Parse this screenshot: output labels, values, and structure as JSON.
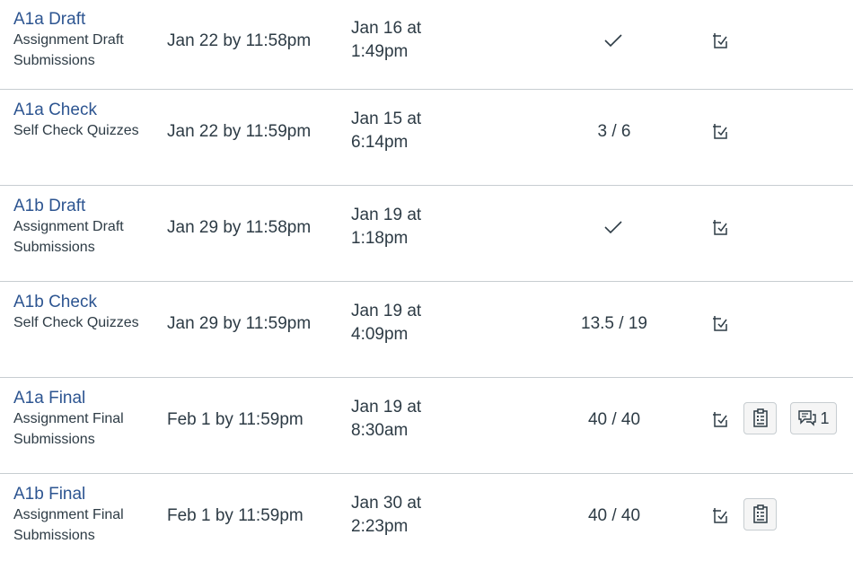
{
  "rows": [
    {
      "name": "A1a Draft",
      "group": "Assignment Draft Submissions",
      "due": "Jan 22 by 11:58pm",
      "submitted_line1": "Jan 16 at",
      "submitted_line2": "1:49pm",
      "score": "",
      "score_icon": "checkmark-icon"
    },
    {
      "name": "A1a Check",
      "group": "Self Check Quizzes",
      "due": "Jan 22 by 11:59pm",
      "submitted_line1": "Jan 15 at",
      "submitted_line2": "6:14pm",
      "score": "3 / 6"
    },
    {
      "name": "A1b Draft",
      "group": "Assignment Draft Submissions",
      "due": "Jan 29 by 11:58pm",
      "submitted_line1": "Jan 19 at",
      "submitted_line2": "1:18pm",
      "score": "",
      "score_icon": "checkmark-icon"
    },
    {
      "name": "A1b Check",
      "group": "Self Check Quizzes",
      "due": "Jan 29 by 11:59pm",
      "submitted_line1": "Jan 19 at",
      "submitted_line2": "4:09pm",
      "score": "13.5 / 19"
    },
    {
      "name": "A1a Final",
      "group": "Assignment Final Submissions",
      "due": "Feb 1 by 11:59pm",
      "submitted_line1": "Jan 19 at",
      "submitted_line2": "8:30am",
      "score": "40 / 40",
      "has_rubric": true,
      "comments_count": "1"
    },
    {
      "name": "A1b Final",
      "group": "Assignment Final Submissions",
      "due": "Feb 1 by 11:59pm",
      "submitted_line1": "Jan 30 at",
      "submitted_line2": "2:23pm",
      "score": "40 / 40",
      "has_rubric": true
    }
  ],
  "icons": {
    "status": "submission-status-icon",
    "rubric": "rubric-icon",
    "comments": "comments-icon",
    "check": "checkmark-icon"
  },
  "colors": {
    "link": "#2d5591",
    "text": "#2d3b45",
    "divider": "#c7cdd1",
    "button_bg": "#f5f5f5"
  }
}
